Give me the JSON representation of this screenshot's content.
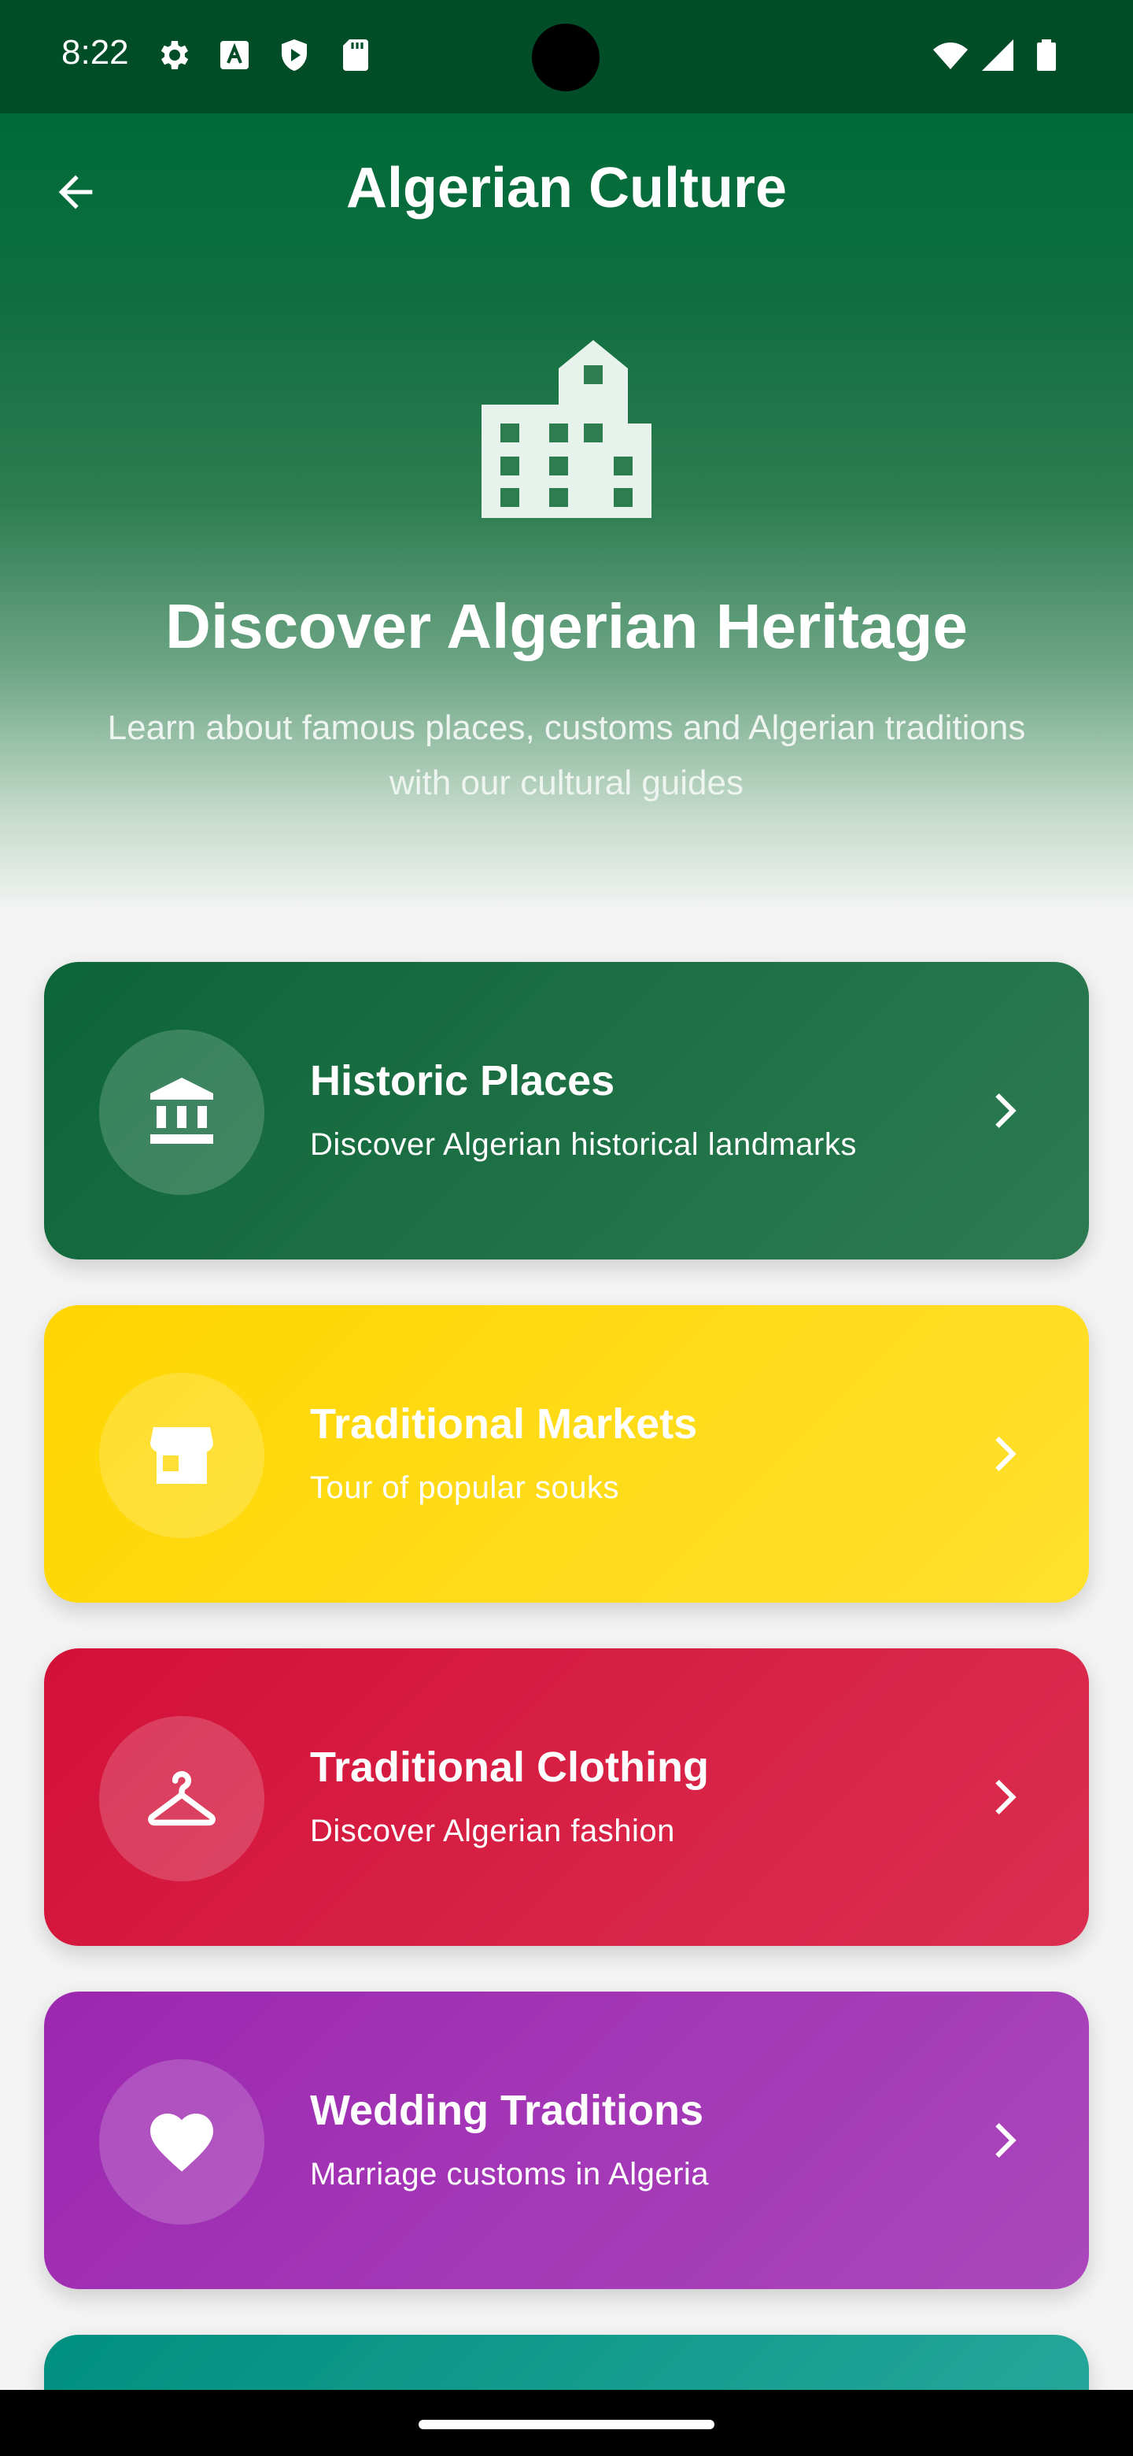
{
  "status_bar": {
    "time": "8:22",
    "left_icons": [
      "settings-icon",
      "font-icon",
      "play-protect-icon",
      "sd-card-icon"
    ],
    "right_icons": [
      "wifi-icon",
      "signal-icon",
      "battery-icon"
    ]
  },
  "app_bar": {
    "title": "Algerian Culture",
    "back_icon": "arrow-back-icon"
  },
  "hero": {
    "icon": "city-building-icon",
    "title": "Discover Algerian Heritage",
    "subtitle": "Learn about famous places, customs and Algerian traditions with our cultural guides"
  },
  "categories": [
    {
      "title": "Historic Places",
      "subtitle": "Discover Algerian historical landmarks",
      "icon": "museum-icon",
      "color": "#0f6b3a"
    },
    {
      "title": "Traditional Markets",
      "subtitle": "Tour of popular souks",
      "icon": "storefront-icon",
      "color": "#ffd60a"
    },
    {
      "title": "Traditional Clothing",
      "subtitle": "Discover Algerian fashion",
      "icon": "hanger-icon",
      "color": "#d4163a"
    },
    {
      "title": "Wedding Traditions",
      "subtitle": "Marriage customs in Algeria",
      "icon": "heart-icon",
      "color": "#9c27b0"
    }
  ],
  "colors": {
    "primary_green": "#006b38",
    "teal_card": "#0f9486"
  }
}
